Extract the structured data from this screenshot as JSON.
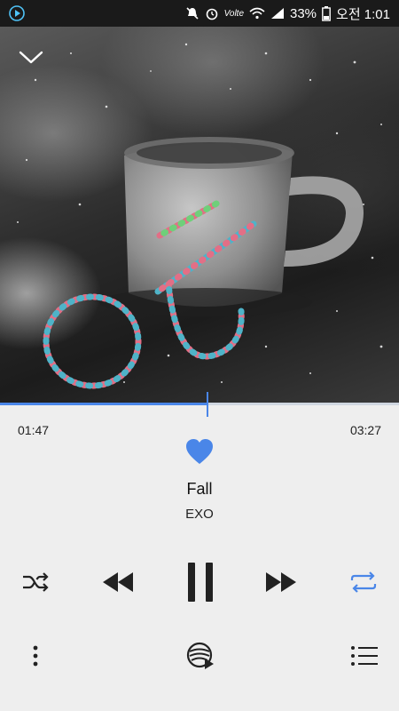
{
  "status_bar": {
    "volte": "Volte",
    "battery": "33%",
    "time": "오전 1:01"
  },
  "icons": {
    "collapse": "chevron-down-icon",
    "favorite": "heart-icon",
    "shuffle": "shuffle-icon",
    "previous": "rewind-icon",
    "play_pause": "pause-icon",
    "next": "fast-forward-icon",
    "repeat": "repeat-icon",
    "more": "more-vertical-icon",
    "sound": "sound-effects-icon",
    "playlist": "playlist-icon"
  },
  "player": {
    "elapsed": "01:47",
    "total": "03:27",
    "progress_fraction": 0.52,
    "favorited": true,
    "title": "Fall",
    "artist": "EXO",
    "shuffle_on": false,
    "repeat_on": true
  },
  "colors": {
    "accent": "#4a86e8",
    "icon": "#222222",
    "background": "#eeeeee"
  }
}
